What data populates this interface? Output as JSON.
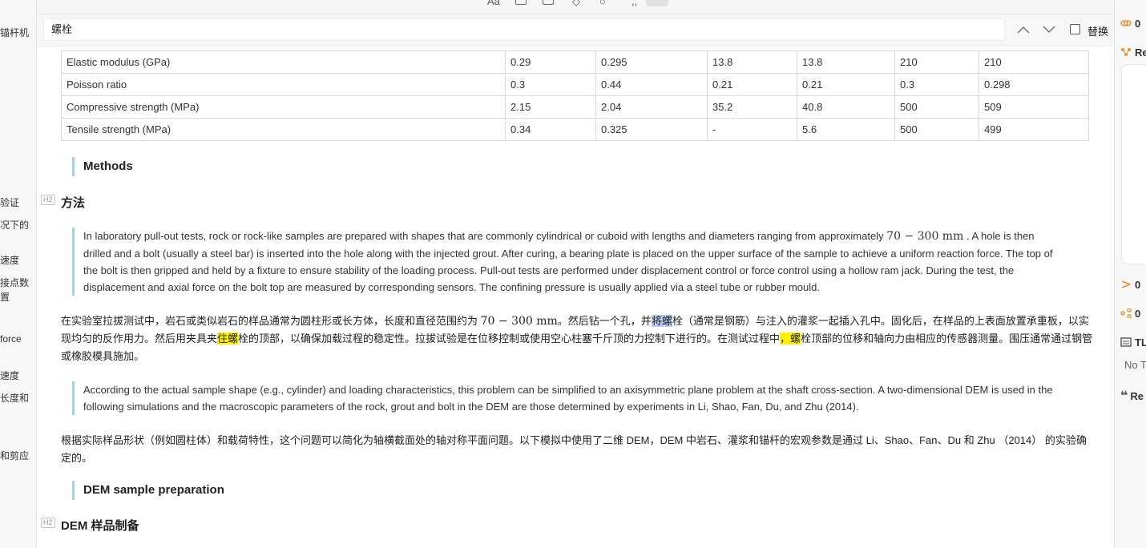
{
  "left_outline": {
    "items": [
      "锚杆机",
      "验证",
      "况下的",
      "速度",
      "接点数",
      "置",
      "force",
      "速度",
      "长度和",
      "和剪应"
    ]
  },
  "find_bar": {
    "query": "螺栓",
    "replace_label": "替换"
  },
  "table": {
    "rows": [
      [
        "Elastic modulus (GPa)",
        "0.29",
        "0.295",
        "13.8",
        "13.8",
        "210",
        "210"
      ],
      [
        "Poisson ratio",
        "0.3",
        "0.44",
        "0.21",
        "0.21",
        "0.3",
        "0.298"
      ],
      [
        "Compressive strength (MPa)",
        "2.15",
        "2.04",
        "35.2",
        "40.8",
        "500",
        "509"
      ],
      [
        "Tensile strength (MPa)",
        "0.34",
        "0.325",
        "-",
        "5.6",
        "500",
        "499"
      ]
    ]
  },
  "content": {
    "methods_quote": "Methods",
    "h2_badge": "H2",
    "heading_methods_cn": "方法",
    "quote1": {
      "before_math": "In laboratory pull-out tests, rock or rock-like samples are prepared with shapes that are commonly cylindrical or cuboid with lengths and diameters ranging from approximately ",
      "math": "70 − 300 mm",
      "after_math": " . A hole is then drilled and a bolt (usually a steel bar) is inserted into the hole along with the injected grout. After curing, a bearing plate is placed on the upper surface of the sample to achieve a uniform reaction force. The top of the bolt is then gripped and held by a fixture to ensure stability of the loading process. Pull-out tests are performed under displacement control or force control using a hollow ram jack. During the test, the displacement and axial force on the bolt top are measured by corresponding sensors. The confining pressure is usually applied via a steel tube or rubber mould."
    },
    "para1": {
      "p1": "在实验室拉拔测试中，岩石或类似岩石的样品通常为圆柱形或长方体，长度和直径范围约为 ",
      "math": "70 − 300 mm",
      "p2": "。然后钻一个孔，并",
      "hl_blue": "将螺",
      "p3": "栓（通常是钢筋）与注入的灌浆一起插入孔中。固化后，在样品的上表面放置承重板，以实现均匀的反作用力。然后用夹具夹",
      "hl_yellow1": "住螺",
      "p4": "栓的顶部，以确保加载过程的稳定性。拉拔试验是在位移控制或使用空心柱塞千斤顶的力控制下进行的。在测试过程中",
      "hl_yellow2": "，螺",
      "p5": "栓顶部的位移和轴向力由相应的传感器测量。围压通常通过钢管或橡胶模具施加。"
    },
    "quote2": "According to the actual sample shape (e.g., cylinder) and loading characteristics, this problem can be simplified to an axisymmetric plane problem at the shaft cross-section. A two-dimensional DEM is used in the following simulations and the macroscopic parameters of the rock, grout and bolt in the DEM are those determined by experiments in Li, Shao, Fan, Du, and Zhu (2014).",
    "para2": "根据实际样品形状（例如圆柱体）和载荷特性，这个问题可以简化为轴横截面处的轴对称平面问题。以下模拟中使用了二维 DEM，DEM 中岩石、灌浆和锚杆的宏观参数是通过 Li、Shao、Fan、Du 和 Zhu （2014） 的实验确定的。",
    "dem_quote": "DEM sample preparation",
    "heading_dem_cn": "DEM 样品制备"
  },
  "right_pane": {
    "count1": "0",
    "label_re": "Re",
    "count2": "0",
    "count3": "0",
    "label_tl": "TL",
    "label_no": "No T",
    "label_re2": "Re"
  },
  "colors": {
    "highlight_yellow": "#fff200",
    "highlight_blue": "#b9cdf3",
    "quote_bar": "#a8cfe0",
    "icon_orange": "#e8903a"
  }
}
